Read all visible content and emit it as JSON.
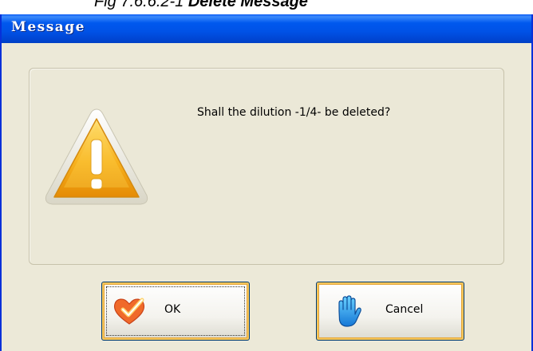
{
  "caption": {
    "prefix": "Fig 7.6.6.2-1 ",
    "title": "Delete Message"
  },
  "window": {
    "title": "Message"
  },
  "dialog": {
    "message": "Shall the dilution -1/4- be deleted?",
    "icon": "warning-icon"
  },
  "buttons": {
    "ok_label": "OK",
    "ok_icon": "heart-check-icon",
    "cancel_label": "Cancel",
    "cancel_icon": "hand-stop-icon"
  },
  "colors": {
    "title_bar": "#0052e6",
    "dialog_bg": "#ece9d8",
    "focus_border": "#e5a537"
  }
}
